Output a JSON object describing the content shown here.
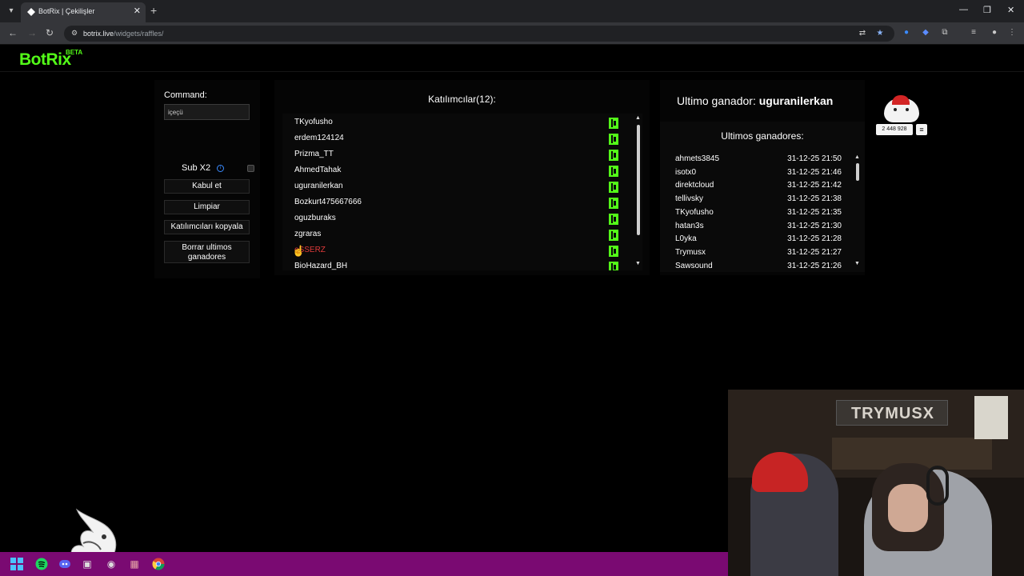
{
  "browser": {
    "tab_title": "BotRix | Çekilişler",
    "url_host": "botrix.live",
    "url_path": "/widgets/raffles/",
    "new_tab_symbol": "+",
    "close_symbol": "✕"
  },
  "site": {
    "logo": "BotRix",
    "logo_badge": "BETA"
  },
  "controls": {
    "command_label": "Command:",
    "command_value": "içeçü",
    "sub_label": "Sub X2",
    "buttons": {
      "accept": "Kabul et",
      "clear": "Limpiar",
      "copy": "Katılımcıları kopyala",
      "delete_winners": "Borrar ultimos ganadores"
    }
  },
  "participants": {
    "title": "Katılımcılar(12):",
    "items": [
      {
        "name": "TKyofusho"
      },
      {
        "name": "erdem124124"
      },
      {
        "name": "Prizma_TT"
      },
      {
        "name": "AhmedTahak"
      },
      {
        "name": "uguranilerkan"
      },
      {
        "name": "Bozkurt475667666"
      },
      {
        "name": "oguzburaks"
      },
      {
        "name": "zgraras"
      },
      {
        "name": "eSSERZ",
        "color": "#e03a3a"
      },
      {
        "name": "BioHazard_BH"
      }
    ]
  },
  "winners": {
    "last_winner_label": "Ultimo ganador:",
    "last_winner": "uguranilerkan",
    "heading": "Ultimos ganadores:",
    "rows": [
      {
        "name": "ahmets3845",
        "date": "31-12-25 21:50"
      },
      {
        "name": "isotx0",
        "date": "31-12-25 21:46"
      },
      {
        "name": "direktcloud",
        "date": "31-12-25 21:42"
      },
      {
        "name": "tellivsky",
        "date": "31-12-25 21:38"
      },
      {
        "name": "TKyofusho",
        "date": "31-12-25 21:35"
      },
      {
        "name": "hatan3s",
        "date": "31-12-25 21:30"
      },
      {
        "name": "L0yka",
        "date": "31-12-25 21:28"
      },
      {
        "name": "Trymusx",
        "date": "31-12-25 21:27"
      },
      {
        "name": "Sawsound",
        "date": "31-12-25 21:26"
      }
    ]
  },
  "sticker": {
    "count": "2 448 928"
  },
  "webcam": {
    "banner": "TRYMUSX"
  },
  "colors": {
    "kick_green": "#53fc18",
    "taskbar": "#7a0a72",
    "highlight_red": "#e03a3a"
  },
  "icons": [
    "tab-search-icon",
    "back-icon",
    "forward-icon",
    "reload-icon",
    "site-info-icon",
    "translate-icon",
    "star-icon",
    "extensions-icon",
    "menu-icon",
    "info-icon",
    "kick-icon",
    "windows-icon",
    "spotify-icon",
    "discord-icon",
    "chrome-icon"
  ]
}
